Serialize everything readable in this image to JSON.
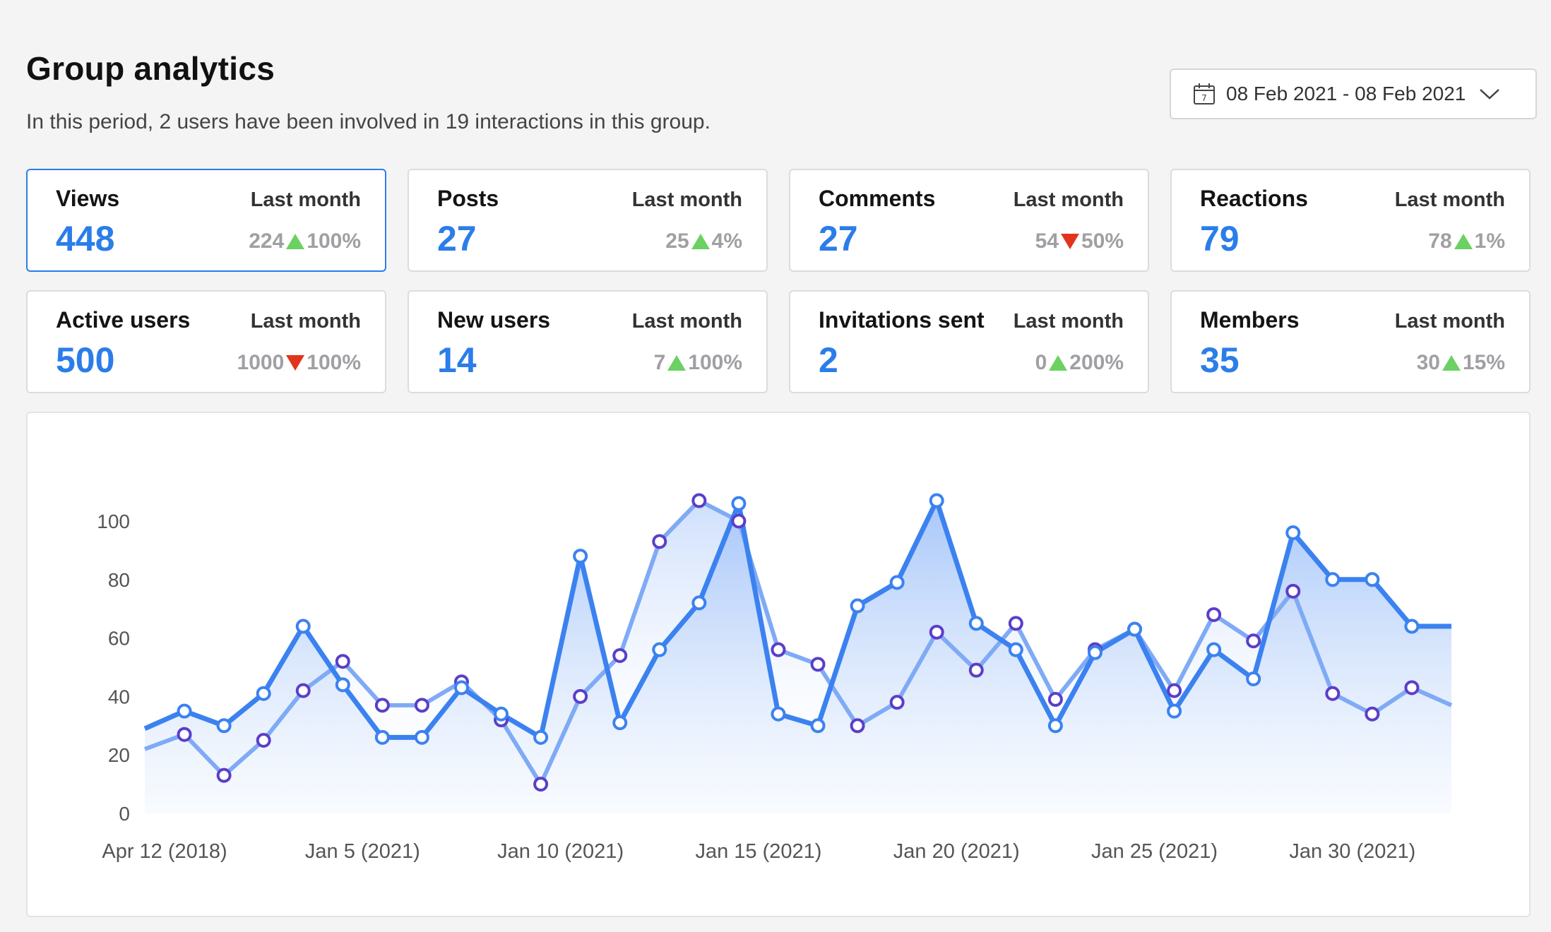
{
  "header": {
    "title": "Group analytics",
    "subtitle": "In this period, 2 users have been involved in 19 interactions in this group."
  },
  "date_range": {
    "label": "08 Feb 2021 - 08 Feb 2021",
    "icon": "calendar-icon",
    "dropdown_icon": "chevron-down-icon"
  },
  "cards": [
    {
      "name": "Views",
      "value": "448",
      "last_label": "Last month",
      "previous": "224",
      "trend": "up",
      "change": "100%",
      "active": true
    },
    {
      "name": "Posts",
      "value": "27",
      "last_label": "Last month",
      "previous": "25",
      "trend": "up",
      "change": "4%"
    },
    {
      "name": "Comments",
      "value": "27",
      "last_label": "Last month",
      "previous": "54",
      "trend": "down",
      "change": "50%"
    },
    {
      "name": "Reactions",
      "value": "79",
      "last_label": "Last month",
      "previous": "78",
      "trend": "up",
      "change": "1%"
    },
    {
      "name": "Active users",
      "value": "500",
      "last_label": "Last month",
      "previous": "1000",
      "trend": "down",
      "change": "100%"
    },
    {
      "name": "New users",
      "value": "14",
      "last_label": "Last month",
      "previous": "7",
      "trend": "up",
      "change": "100%"
    },
    {
      "name": "Invitations sent",
      "value": "2",
      "last_label": "Last month",
      "previous": "0",
      "trend": "up",
      "change": "200%"
    },
    {
      "name": "Members",
      "value": "35",
      "last_label": "Last month",
      "previous": "30",
      "trend": "up",
      "change": "15%"
    }
  ],
  "colors": {
    "accent": "#2b7de9",
    "up": "#6bd162",
    "down": "#e2341d",
    "series_a_line": "#3b82f0",
    "series_b_line": "#7faaf5",
    "series_b_marker": "#5a3fc8"
  },
  "chart_data": {
    "type": "area",
    "ylim": [
      0,
      110
    ],
    "yticks": [
      0,
      20,
      40,
      60,
      80,
      100
    ],
    "x_tick_labels": [
      "Apr 12 (2018)",
      "Jan 5 (2021)",
      "Jan 10 (2021)",
      "Jan 15 (2021)",
      "Jan 20 (2021)",
      "Jan 25 (2021)",
      "Jan 30 (2021)"
    ],
    "x_tick_index": [
      0.5,
      5.5,
      10.5,
      15.5,
      20.5,
      25.5,
      30.5
    ],
    "grid": false,
    "legend": "none",
    "series": [
      {
        "values": [
          29,
          35,
          30,
          41,
          64,
          44,
          26,
          26,
          43,
          34,
          26,
          88,
          31,
          56,
          72,
          106,
          34,
          30,
          71,
          79,
          107,
          65,
          56,
          30,
          55,
          63,
          35,
          56,
          46,
          96,
          80,
          80,
          64,
          64
        ]
      },
      {
        "values": [
          22,
          27,
          13,
          25,
          42,
          52,
          37,
          37,
          45,
          32,
          10,
          40,
          54,
          93,
          107,
          100,
          56,
          51,
          30,
          38,
          62,
          49,
          65,
          39,
          56,
          63,
          42,
          68,
          59,
          76,
          41,
          34,
          43,
          37
        ]
      }
    ]
  }
}
